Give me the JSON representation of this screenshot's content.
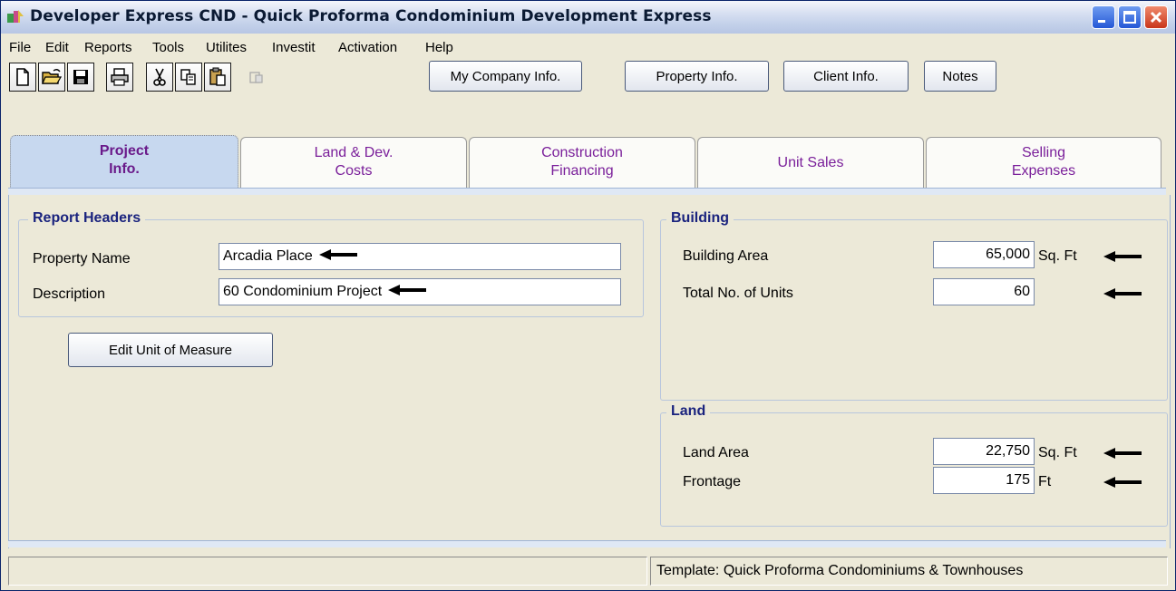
{
  "window": {
    "title": "Developer Express  CND - Quick Proforma Condominium Development  Express"
  },
  "menu": [
    "File",
    "Edit",
    "Reports",
    "Tools",
    "Utilites",
    "Investit",
    "Activation",
    "Help"
  ],
  "toolbar": {
    "icons": [
      "new-document-icon",
      "open-folder-icon",
      "save-disk-icon",
      "print-icon",
      "cut-scissors-icon",
      "copy-icon",
      "paste-icon",
      "disabled-tool-icon"
    ],
    "buttons": {
      "company": "My Company Info.",
      "property": "Property Info.",
      "client": "Client Info.",
      "notes": "Notes"
    }
  },
  "tabs": [
    {
      "line1": "Project",
      "line2": "Info.",
      "active": true
    },
    {
      "line1": "Land & Dev.",
      "line2": "Costs",
      "active": false
    },
    {
      "line1": "Construction",
      "line2": "Financing",
      "active": false
    },
    {
      "line1": "Unit Sales",
      "line2": "",
      "active": false
    },
    {
      "line1": "Selling",
      "line2": "Expenses",
      "active": false
    }
  ],
  "report_headers": {
    "title": "Report Headers",
    "property_name_label": "Property Name",
    "property_name_value": "Arcadia Place",
    "description_label": "Description",
    "description_value": "60 Condominium Project"
  },
  "edit_uom_button": "Edit Unit of Measure",
  "building": {
    "title": "Building",
    "area_label": "Building Area",
    "area_value": "65,000",
    "area_unit": "Sq. Ft",
    "units_label": "Total No. of Units",
    "units_value": "60"
  },
  "land": {
    "title": "Land",
    "area_label": "Land Area",
    "area_value": "22,750",
    "area_unit": "Sq. Ft",
    "frontage_label": "Frontage",
    "frontage_value": "175",
    "frontage_unit": "Ft"
  },
  "status": {
    "left": "",
    "template": "Template: Quick Proforma Condominiums & Townhouses"
  },
  "colors": {
    "tab_text": "#7a1f9a",
    "group_title": "#1a237e",
    "active_tab_bg": "#c7d8ef"
  }
}
